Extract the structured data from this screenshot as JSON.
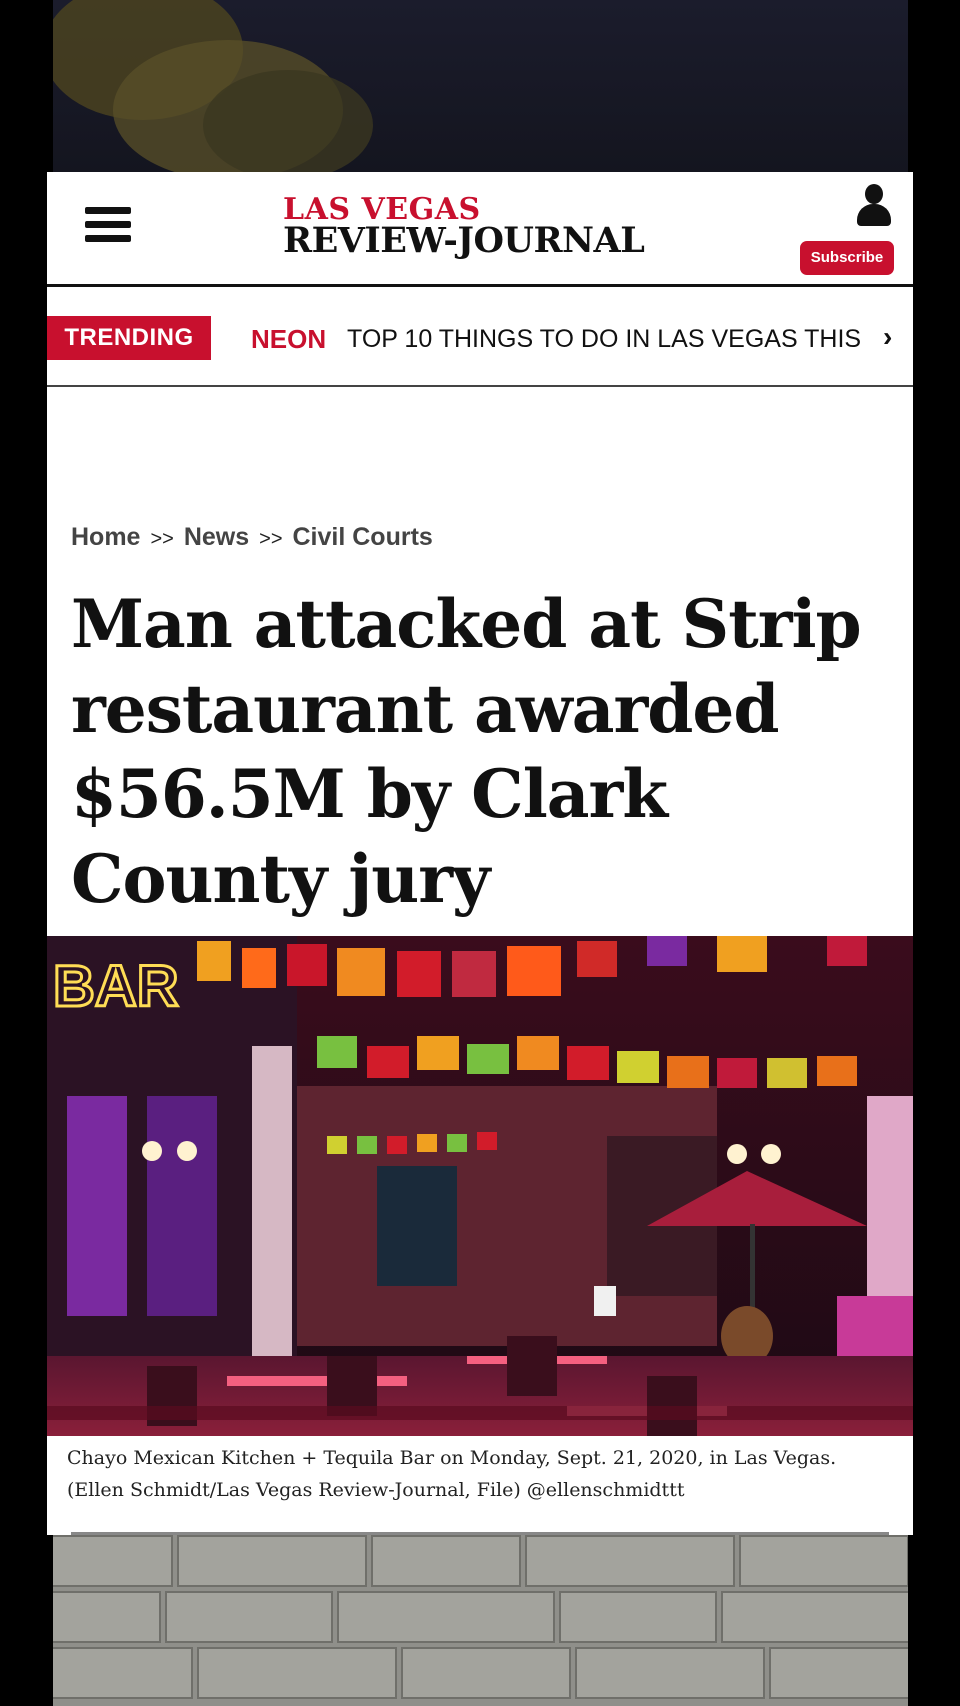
{
  "header": {
    "logo_top": "LAS VEGAS",
    "logo_bottom": "REVIEW-JOURNAL",
    "subscribe_label": "Subscribe"
  },
  "trending": {
    "badge": "TRENDING",
    "tag": "NEON",
    "text": "TOP 10 THINGS TO DO IN LAS VEGAS THIS"
  },
  "breadcrumb": {
    "items": [
      "Home",
      "News",
      "Civil Courts"
    ],
    "separator": ">>"
  },
  "article": {
    "headline": "Man attacked at Strip restaurant awarded $56.5M by Clark County jury",
    "caption": "Chayo Mexican Kitchen + Tequila Bar on Monday, Sept. 21, 2020, in Las Vegas. (Ellen Schmidt/Las Vegas Review-Journal, File) @ellenschmidttt"
  },
  "photo_signage": {
    "bar_sign": "BAR"
  },
  "colors": {
    "brand_red": "#c8102e",
    "text_dark": "#111111"
  }
}
